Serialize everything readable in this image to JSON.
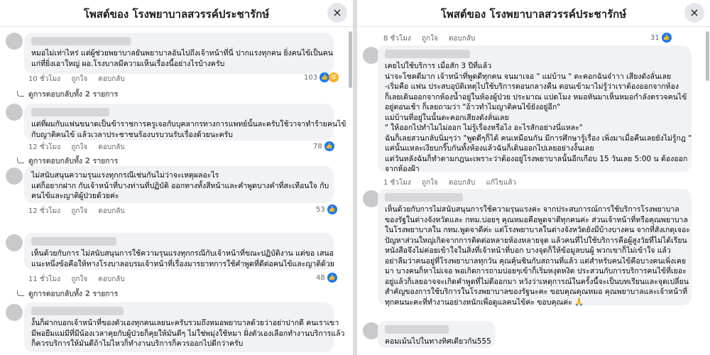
{
  "left": {
    "title": "โพสต์ของ โรงพยาบาลสวรรค์ประชารักษ์",
    "close_icon": "×",
    "comments": [
      {
        "lines": [
          "หมอไม่เท่าไหร่ แต่ผู้ช่วยพยาบาลยันพยาบาลอันไปถึงเจ้าหน้าที่นี่ ปากแรงทุกคน ยิ่งคนไข้เป็นคน",
          "แก่ที่ยิ่งเอาใหญ่ ผอ.โรงบาลมีความเห็นเรื่องนี้อย่างไรบ้างครับ"
        ],
        "time": "10 ชั่วโมง",
        "like": "ถูกใจ",
        "reply": "ตอบกลับ",
        "reactions": "103",
        "replies_link": "ดูการตอบกลับทั้ง 2 รายการ"
      },
      {
        "lines": [
          "แต่ที่ผมกับแฟนขนาดเป็นข้าราชการครูเจอกับบุคลากรทางการแพทย์นั้นละครับใช้วาจาทำร้ายคนไข้",
          "กับญาติคนไข้ แล้วเวลาประชาชนร้องบรบวนรับเรื่องด้วยนะครับ"
        ],
        "time": "12 ชั่วโมง",
        "like": "ถูกใจ",
        "reply": "ตอบกลับ",
        "reactions": "78",
        "replies_link": "ดูการตอบกลับทั้ง 2 รายการ"
      },
      {
        "lines": [
          "ไม่สนับสนุนความรุนแรงทุกกรณีเช่นกันไม่ว่าจะเหตุผลอะไร",
          "แต่ก็อยากฝาก กับเจ้าหน้าที่บางท่านที่ปฏิบัติ ออกทางทั้งสีหน้าและคำพูดบางคำที่สะเทือนใจ กับ",
          "คนไข้และญาติผู้ป่วยด้วยค่ะ"
        ],
        "time": "12 ชั่วโมง",
        "like": "ถูกใจ",
        "reply": "ตอบกลับ",
        "reactions": "53"
      },
      {
        "lines": [
          "เห็นด้วยกับการ ไม่สนับสนุนการใช้ความรุนแรงทุกกรณีกับเจ้าหน้าที่ขณะปฏิบัติงาน แต่ขอ เสนอ",
          "แนะหนึ่งข้อคือให้ทางโรงบาลอบรมเจ้าหน้าที่เรื่องมารยาทการใช้คำพูดที่ดีต่อคนไข้และญาติด้วย"
        ],
        "time": "11 ชั่วโมง",
        "like": "ถูกใจ",
        "reply": "ตอบกลับ",
        "reactions": "48",
        "replies_link": "ดูการตอบกลับทั้ง 2 รายการ"
      },
      {
        "lines": [
          "งั้นก็ฝากบอกเจ้าหน้าที่ของตัวเองทุกคนเลยนะครับรวมถึงหมอพยาบาลด้วยว่าอย่าปากดี คนเราเขา",
          "มีพอยืมแม่มีที่มีน้องเวลาคุยกับผู้ป่วยก็คุยให้มันดีๆ ไม่ใช่พมุ่งใช้หมา ฝั่งตัวเองเลือกทำงานบริการแล้ว",
          "ก็ควรบริการให้มันดีถ้าไม่ไหวก็ทำงานบริการก็ควรออกไปดีกว่าครับ"
        ]
      }
    ]
  },
  "right": {
    "title": "โพสต์ของ โรงพยาบาลสวรรค์ประชารักษ์",
    "close_icon": "×",
    "top_meta": {
      "time": "8 ชั่วโมง",
      "like": "ถูกใจ",
      "reply": "ตอบกลับ",
      "reactions": "31"
    },
    "comments": [
      {
        "lines": [
          "เคยไปใช้บริการ เมื่อสัก 3 ปีที่แล้ว",
          "น่าจะโชคดีมาก เจ้าหน้าที่พูดดีทุกคน จนมาเจอ \" แม่บ้าน \" ตะคอกฉันจ๋าาา เสียงดังลั่นเลย",
          "-เริ่มคือ แฟน ประสบอุบัติเหตุไปใช้บริการตอนกลางคืน ตอนเข้ามาไม่รู้ว่าเราต้องออกจากห้อง",
          "ก็เลยเดินออกจากห้องน้ำอยู่ในห้องผู้ป่วย ประมาณ แปดโมง หมอหันมาเห็นหมอกำลังตรวจคนไข้",
          "อยู่ตอนเช้า ก็เลยถามว่า \"อ้าวทำไมญาติคนไข้ยังอยู่อีก\"",
          "แม่บ้านที่อยู่ในนั้นตะคอกเสียงดังลั่นเลย",
          "\" ให้ออกไปทำไมไม่ออก ไม่รู้เรื่องหรือไง อะไรสักอย่างนี่แหละ\"",
          "ฉันก็เลยสวนกลับนิ่มๆว่า \"พูดดีๆก็ได้ คนเหมือนกัน มีการศึกษารู้เรื่อง เพิ่งมาเมื่อคืนเลยยังไม่รู้กฎ \"",
          "แค่นั้นแหละเงียบกริ๊บกันทั้งห้องแล้วฉันก็เดินออกไปเลยอย่างงั้นเลย",
          "แต่วันหลังฉันก็ทำตามกฎนะเพราะว่าต้องอยู่โรงพยาบาลนั้นอีกเกือบ 15 วันเลย 5:00 น ต้องออก",
          "จากห้องฝ้า"
        ],
        "time": "1 ชั่วโมง",
        "like": "ถูกใจ",
        "reply": "ตอบกลับ",
        "edited": "แก้ไขแล้ว"
      },
      {
        "lines": [
          "เห็นด้วยกับการไม่สนับสนุนการใช้ความรุนแรงค่ะ จากประสบการณ์การใช้บริการโรงพยาบาล",
          "ของรัฐในต่างจังหวัดและ กทม.บ่อยๆ คุณหมอคือพูดจาดีทุกคนค่ะ ส่วนเจ้าหน้าที่หรือคุณพยาบาล",
          "ในโรงพยาบาลใน กทม.พูดจาดีค่ะ แต่โรงพยาบาลในต่างจังหวัดยังมีบ้างบางคน จากที่สังเกตุเจอะ",
          "ปัญหาส่วนใหญ่เกิดจากการติดต่อหลายห้องหลายจุด แล้วคนที่ไปใช้บริการคือผู้สูงวัยที่ไม่ได้เรียน",
          "หนังสือจึงไม่ค่อยเข้าใจในสิ่งที่เจ้าหน้าที่บอก บางจุดก็ให้ข้อมูลบนผู้ พวกเขาก็ไม่เข้าใจ แล้ว",
          "อย่าลืมว่าคนอยู่ที่โรงพยาบาลทุกวัน คุณคุ้นชินกับสถานที่แล้ว แต่สำหรับคนไข้คือบางคนเพิ่งเคย",
          "มา บางคนก็หาไม่เจอ พอเกิดการถามบ่อยๆเข้าก็เริ่มหงุดหงิด ประสวนกับการบริการคนไข้ที่เยอะ",
          "อยู่แล้วก็เลยอาจจะเกิดคำพูดที่ไม่ดีออกมา หวังว่าเหตุการณ์ในครั้งนี้จะเป็นบทเรียนและจุดเปลี่ยน",
          "สำคัญของการใช้บริการในโรงพยาบาลของรัฐนะคะ ขอบคุณคุณหมอ คุณพยาบาลและเจ้าหน้าที่",
          "ทุกคนนะคะที่ทำงานอย่างหนักเพื่อดูแลคนไข้ค่ะ ขอบคุณค่ะ 🙏"
        ]
      },
      {
        "lines": [
          "คอมเม้นไปในทางทิศเดียวกัน555"
        ]
      }
    ]
  }
}
